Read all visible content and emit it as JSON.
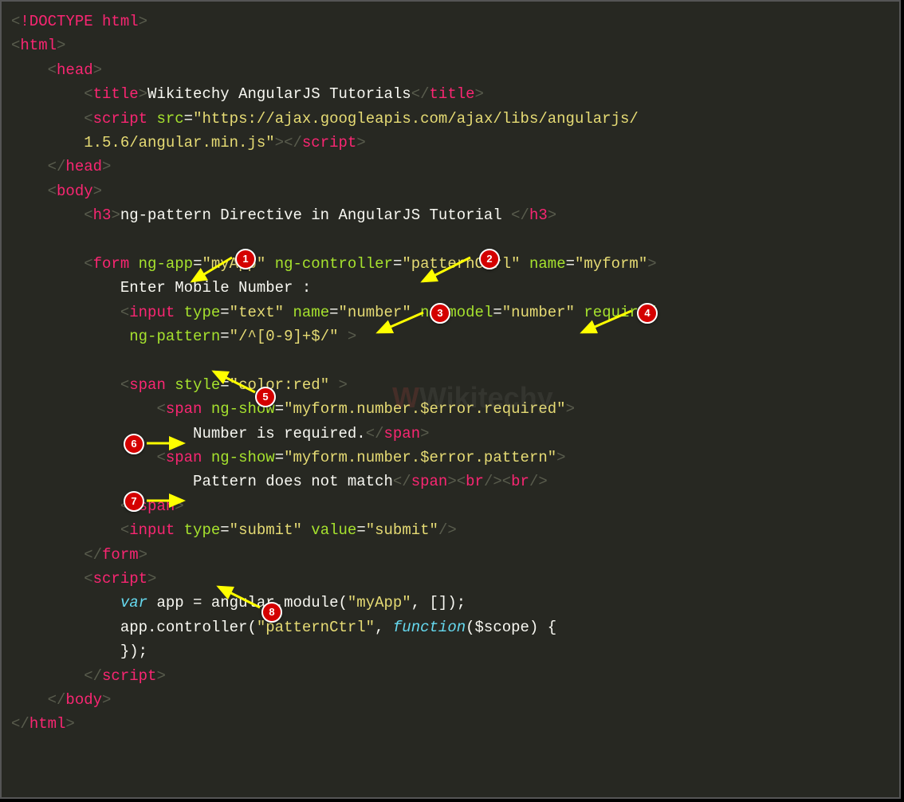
{
  "code": {
    "l1_doctype": "!DOCTYPE html",
    "l2_html": "html",
    "l3_head": "head",
    "l4_title": "title",
    "l4_title_text": "Wikitechy AngularJS Tutorials",
    "l5_script": "script",
    "l5_src_attr": "src",
    "l5_src_val": "\"https://ajax.googleapis.com/ajax/libs/angularjs/",
    "l6_src_val2": "1.5.6/angular.min.js\"",
    "l8_body": "body",
    "l9_h3": "h3",
    "l9_h3_text": "ng-pattern Directive in AngularJS Tutorial ",
    "l11_form": "form",
    "l11_ngapp": "ng-app",
    "l11_ngapp_val": "\"myApp\"",
    "l11_ngctrl": "ng-controller",
    "l11_ngctrl_val": "\"patternCtrl\"",
    "l11_name": "name",
    "l11_name_val": "\"myform\"",
    "l12_text": "Enter Mobile Number :",
    "l13_input": "input",
    "l13_type": "type",
    "l13_type_val": "\"text\"",
    "l13_name": "name",
    "l13_name_val": "\"number\"",
    "l13_ngmodel": "ng-model",
    "l13_ngmodel_val": "\"number\"",
    "l13_required": "required",
    "l14_ngpattern": "ng-pattern",
    "l14_ngpattern_val": "\"/^[0-9]+$/\"",
    "l16_span": "span",
    "l16_style": "style",
    "l16_style_val": "\"color:red\"",
    "l17_span": "span",
    "l17_ngshow": "ng-show",
    "l17_ngshow_val": "\"myform.number.$error.required\"",
    "l18_text": "Number is required.",
    "l19_span": "span",
    "l19_ngshow": "ng-show",
    "l19_ngshow_val": "\"myform.number.$error.pattern\"",
    "l20_text": "Pattern does not match",
    "l20_br": "br",
    "l22_input": "input",
    "l22_type": "type",
    "l22_type_val": "\"submit\"",
    "l22_value": "value",
    "l22_value_val": "\"submit\"",
    "l24_script": "script",
    "l25_var": "var",
    "l25_text": " app = angular.module(",
    "l25_str": "\"myApp\"",
    "l25_end": ", []);",
    "l26_text": "app.controller(",
    "l26_str": "\"patternCtrl\"",
    "l26_mid": ", ",
    "l26_func": "function",
    "l26_end": "($scope) {",
    "l27_text": "});"
  },
  "annotations": {
    "badges": [
      "1",
      "2",
      "3",
      "4",
      "5",
      "6",
      "7",
      "8"
    ]
  },
  "watermark": "Wikitechy"
}
